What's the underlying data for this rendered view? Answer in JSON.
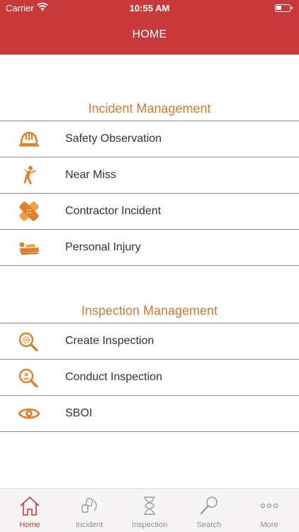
{
  "status_bar": {
    "carrier": "Carrier",
    "time": "10:55 AM"
  },
  "nav": {
    "title": "HOME"
  },
  "sections": [
    {
      "header": "Incident Management",
      "items": [
        {
          "label": "Safety Observation",
          "icon": "hard-hat-icon"
        },
        {
          "label": "Near Miss",
          "icon": "falling-person-icon"
        },
        {
          "label": "Contractor Incident",
          "icon": "bandage-icon"
        },
        {
          "label": "Personal Injury",
          "icon": "injured-person-icon"
        }
      ]
    },
    {
      "header": "Inspection Management",
      "items": [
        {
          "label": "Create Inspection",
          "icon": "magnifier-gear-icon"
        },
        {
          "label": "Conduct Inspection",
          "icon": "magnifier-person-icon"
        },
        {
          "label": "SBOI",
          "icon": "eye-icon"
        }
      ]
    }
  ],
  "tabs": [
    {
      "label": "Home",
      "icon": "home-icon",
      "active": true
    },
    {
      "label": "Incident",
      "icon": "incident-icon"
    },
    {
      "label": "Inspection",
      "icon": "hourglass-icon"
    },
    {
      "label": "Search",
      "icon": "search-icon"
    },
    {
      "label": "More",
      "icon": "more-icon"
    }
  ],
  "colors": {
    "brand_red": "#c8393c",
    "accent_orange": "#d4792f",
    "tab_inactive": "#8e8e8e"
  }
}
